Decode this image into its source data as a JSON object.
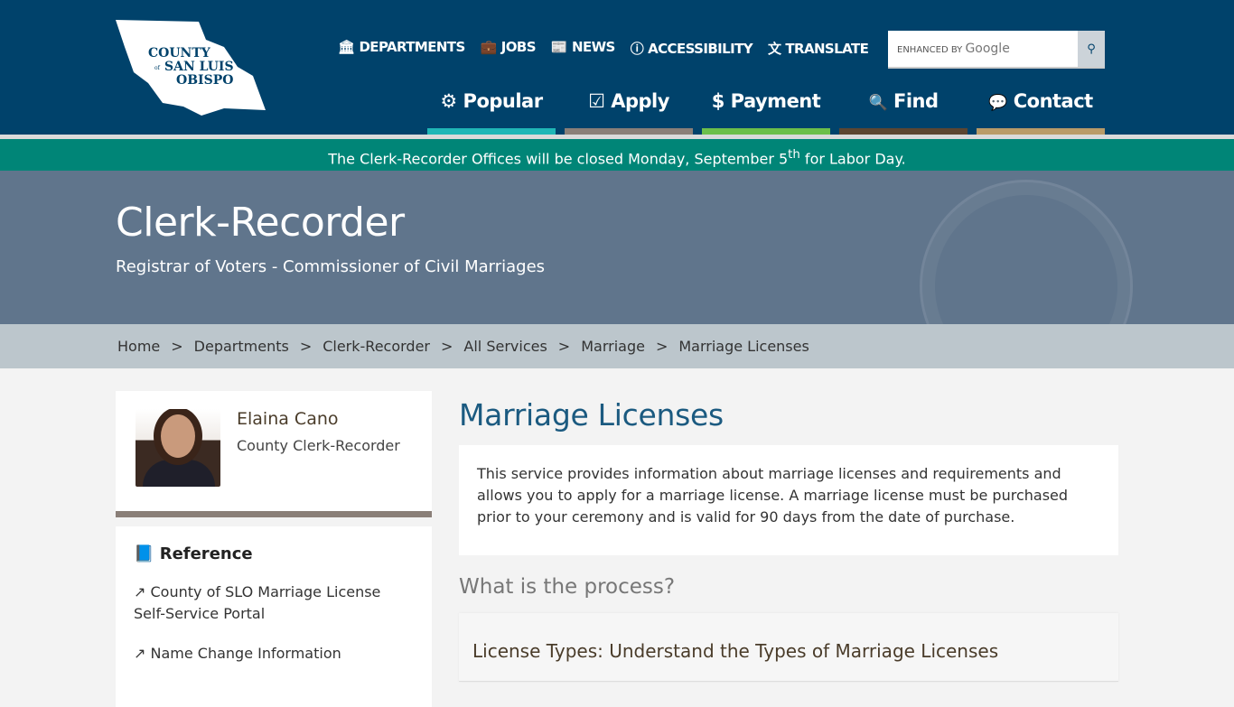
{
  "logo": {
    "line1": "COUNTY",
    "of": "of",
    "line2": "SAN LUIS",
    "line3": "OBISPO"
  },
  "utility_nav": [
    {
      "icon": "bank-icon",
      "glyph": "🏛",
      "label": "DEPARTMENTS"
    },
    {
      "icon": "briefcase-icon",
      "glyph": "💼",
      "label": "JOBS"
    },
    {
      "icon": "newspaper-icon",
      "glyph": "📰",
      "label": "NEWS"
    },
    {
      "icon": "accessibility-icon",
      "glyph": "ⓘ",
      "label": "ACCESSIBILITY"
    },
    {
      "icon": "translate-icon",
      "glyph": "文",
      "label": "TRANSLATE"
    }
  ],
  "search": {
    "enhanced": "ENHANCED BY",
    "google": "Google",
    "icon": "search-icon"
  },
  "main_nav": [
    {
      "icon": "gear-icon",
      "glyph": "⚙",
      "label": "Popular",
      "color": "#1fb6b6"
    },
    {
      "icon": "checkbox-icon",
      "glyph": "☑",
      "label": "Apply",
      "color": "#8a7f78"
    },
    {
      "icon": "dollar-icon",
      "glyph": "$",
      "label": "Payment",
      "color": "#6cbf4a"
    },
    {
      "icon": "search-icon",
      "glyph": "🔍",
      "label": "Find",
      "color": "#5c4631"
    },
    {
      "icon": "chat-icon",
      "glyph": "💬",
      "label": "Contact",
      "color": "#b99b68"
    }
  ],
  "alert": {
    "before": "The Clerk-Recorder Offices will be closed Monday, September 5",
    "sup": "th",
    "after": " for Labor Day."
  },
  "hero": {
    "title": "Clerk-Recorder",
    "subtitle": "Registrar of Voters - Commissioner of Civil Marriages"
  },
  "breadcrumb": [
    "Home",
    "Departments",
    "Clerk-Recorder",
    "All Services",
    "Marriage",
    "Marriage Licenses"
  ],
  "breadcrumb_sep": ">",
  "official": {
    "name": "Elaina Cano",
    "title": "County Clerk-Recorder"
  },
  "reference": {
    "heading": "Reference",
    "links": [
      "County of SLO Marriage License Self-Service Portal",
      "Name Change Information"
    ]
  },
  "main": {
    "title": "Marriage Licenses",
    "intro": "This service provides information about marriage licenses and requirements and allows you to apply for a marriage license. A marriage license must be purchased prior to your ceremony and is valid for 90 days from the date of purchase.",
    "process_heading": "What is the process?",
    "accordion": "License Types: Understand the Types of Marriage Licenses"
  }
}
